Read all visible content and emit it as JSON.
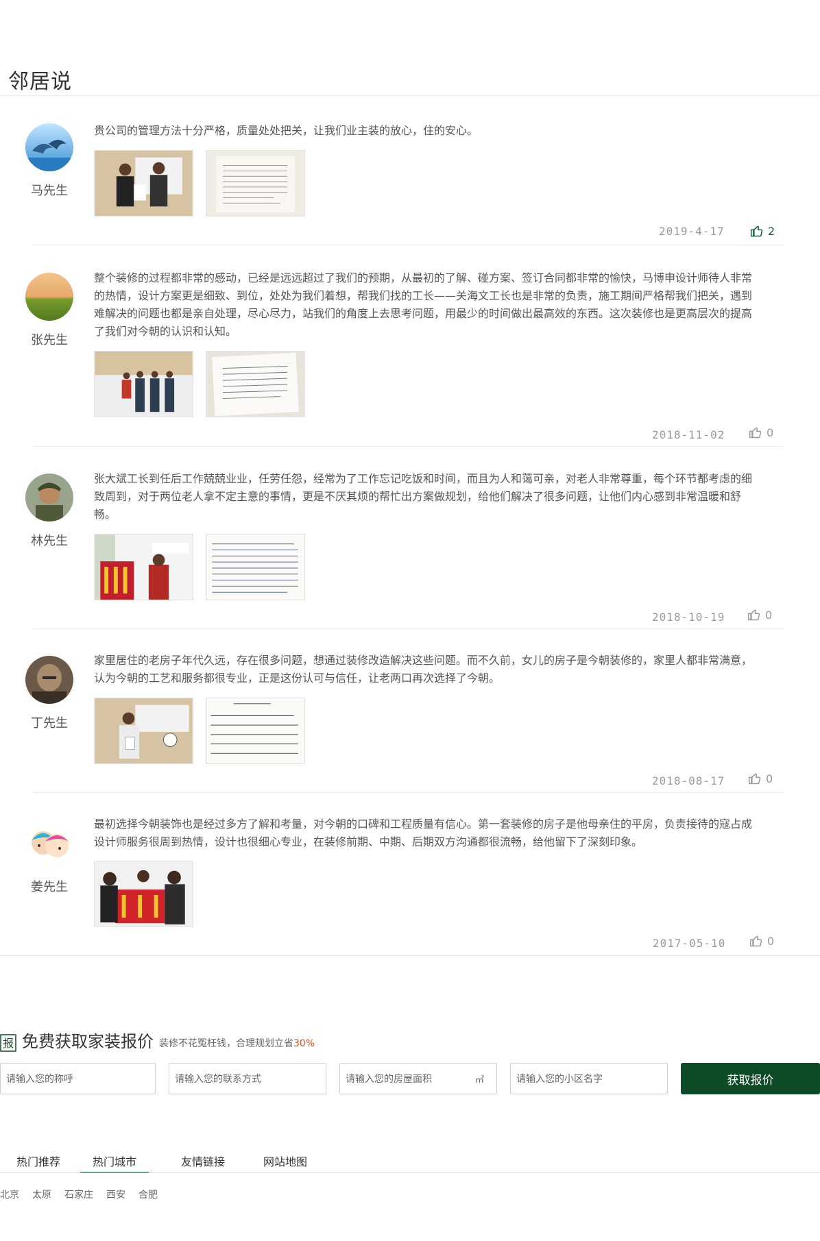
{
  "page": {
    "title": "邻居说"
  },
  "reviews": [
    {
      "author": "马先生",
      "text": "贵公司的管理方法十分严格，质量处处把关，让我们业主装的放心，住的安心。",
      "date": "2019-4-17",
      "likes": "2",
      "photos": [
        "photo",
        "letter"
      ],
      "avatar": "dolphin-avatar"
    },
    {
      "author": "张先生",
      "text": "整个装修的过程都非常的感动，已经是远远超过了我们的预期，从最初的了解、碰方案、签订合同都非常的愉快，马博申设计师待人非常的热情，设计方案更是细致、到位，处处为我们着想，帮我们找的工长——关海文工长也是非常的负责，施工期间严格帮我们把关，遇到难解决的问题也都是亲自处理，尽心尽力，站我们的角度上去思考问题，用最少的时间做出最高效的东西。这次装修也是更高层次的提高了我们对今朝的认识和认知。",
      "date": "2018-11-02",
      "likes": "0",
      "photos": [
        "photo",
        "letter"
      ],
      "avatar": "field-avatar"
    },
    {
      "author": "林先生",
      "text": "张大斌工长到任后工作兢兢业业，任劳任怨，经常为了工作忘记吃饭和时间，而且为人和蔼可亲，对老人非常尊重，每个环节都考虑的细致周到，对于两位老人拿不定主意的事情，更是不厌其烦的帮忙出方案做规划，给他们解决了很多问题，让他们内心感到非常温暖和舒畅。",
      "date": "2018-10-19",
      "likes": "0",
      "photos": [
        "photo",
        "letter"
      ],
      "avatar": "portrait-avatar"
    },
    {
      "author": "丁先生",
      "text": "家里居住的老房子年代久远，存在很多问题，想通过装修改造解决这些问题。而不久前，女儿的房子是今朝装修的，家里人都非常满意，认为今朝的工艺和服务都很专业，正是这份认可与信任，让老两口再次选择了今朝。",
      "date": "2018-08-17",
      "likes": "0",
      "photos": [
        "photo",
        "letter"
      ],
      "avatar": "monk-avatar"
    },
    {
      "author": "姜先生",
      "text": "最初选择今朝装饰也是经过多方了解和考量，对今朝的口碑和工程质量有信心。第一套装修的房子是他母亲住的平房，负责接待的寇占成设计师服务很周到热情，设计也很细心专业，在装修前期、中期、后期双方沟通都很流畅，给他留下了深刻印象。",
      "date": "2017-05-10",
      "likes": "0",
      "photos": [
        "photo"
      ],
      "avatar": "cartoon-avatar"
    }
  ],
  "quote": {
    "icon_text": "报",
    "title": "免费获取家装报价",
    "subtitle": "装修不花冤枉钱，合理规划立省",
    "subtitle_highlight": "30%",
    "fields": [
      {
        "placeholder": "请输入您的称呼"
      },
      {
        "placeholder": "请输入您的联系方式"
      },
      {
        "placeholder": "请输入您的房屋面积",
        "unit": "㎡"
      },
      {
        "placeholder": "请输入您的小区名字"
      }
    ],
    "button": "获取报价"
  },
  "tabs": [
    "热门推荐",
    "热门城市",
    "友情链接",
    "网站地图"
  ],
  "active_tab": "热门城市",
  "cities": [
    "北京",
    "太原",
    "石家庄",
    "西安",
    "合肥"
  ],
  "colors": {
    "brand_green": "#0c4b25",
    "highlight": "#e2511c",
    "muted": "#999999"
  }
}
